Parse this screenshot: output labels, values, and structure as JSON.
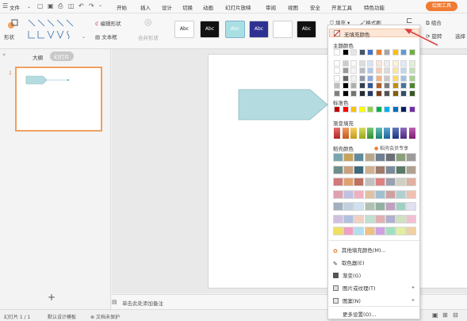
{
  "menu": {
    "file": "文件",
    "tabs": [
      "开始",
      "插入",
      "设计",
      "切换",
      "动画",
      "幻灯片放映",
      "审阅",
      "视图",
      "安全",
      "开发工具",
      "特色功能"
    ],
    "drawing_tool": "绘图工具"
  },
  "ribbon": {
    "shape_label": "形状",
    "edit_shape": "编辑形状",
    "textbox": "文本框",
    "merge_shapes": "合并形状",
    "style_sample": "Abc",
    "fill": "填充",
    "format_painter": "格式刷",
    "group": "组合",
    "rotate": "旋转",
    "select": "选择"
  },
  "left_panel": {
    "tab_outline": "大纲",
    "tab_slides": "幻灯片",
    "slide_number": "1",
    "add_icon": "+"
  },
  "notes": {
    "placeholder": "单击此处添加备注"
  },
  "status": {
    "slide_count": "幻灯片 1 / 1",
    "template": "默认设计模板",
    "protection": "文档未保护"
  },
  "fill_menu": {
    "no_fill": "无填充颜色",
    "theme_colors": "主题颜色",
    "standard_colors": "标准色",
    "gradient_fill": "渐变填充",
    "daoke_colors": "稻壳颜色",
    "member_share": "稻壳会员专享",
    "more_colors": "其他填充颜色(M)...",
    "eyedropper": "取色器(E)",
    "gradient": "渐变(G)",
    "picture_texture": "图片或纹理(T)",
    "pattern": "图案(N)",
    "more_settings": "更多设置(O)..."
  },
  "colors": {
    "accent": "#f07b33",
    "shape_fill": "#b4dce0",
    "selected_style": "#a9dfe3",
    "arrow": "#e04040"
  },
  "theme_row": [
    "#ffffff",
    "#000000",
    "#e7e6e6",
    "#44546a",
    "#4472c4",
    "#ed7d31",
    "#a5a5a5",
    "#ffc000",
    "#5b9bd5",
    "#70ad47"
  ],
  "standard_row": [
    "#c00000",
    "#ff0000",
    "#ffc000",
    "#ffff00",
    "#92d050",
    "#00b050",
    "#00b0f0",
    "#0070c0",
    "#002060",
    "#7030a0"
  ],
  "gradient_row": [
    "#e03030",
    "#f07020",
    "#f0c020",
    "#c0d020",
    "#40b040",
    "#20a090",
    "#2080c0",
    "#2040a0",
    "#6030a0",
    "#a02090"
  ],
  "daoke_rows": [
    [
      "#7aa6b0",
      "#c7a35a",
      "#5f8a9d",
      "#b7a78a",
      "#6f7f8f",
      "#6b6f77",
      "#8aa07a",
      "#9c9c9c"
    ],
    [
      "#6c8f8c",
      "#c9a080",
      "#3f6a7a",
      "#d0b090",
      "#a07a6a",
      "#7a8a9a",
      "#5a7a6a",
      "#b0a090"
    ],
    [
      "#d07a7a",
      "#e0a070",
      "#c07060",
      "#c0c0c0",
      "#e08080",
      "#9aa0b0",
      "#d0d0c0",
      "#e0b0a0"
    ],
    [
      "#e0a0b0",
      "#c0c0e0",
      "#f0b0c0",
      "#e0c0a0",
      "#a0c0d0",
      "#d0a0a0",
      "#b0d0d0",
      "#f0c0b0"
    ],
    [
      "#a0b0c0",
      "#c0d0e0",
      "#d0e0f0",
      "#b0c0b0",
      "#90b0a0",
      "#c0a0c0",
      "#a0d0c0",
      "#e0e0f0"
    ],
    [
      "#d0c0e0",
      "#b0c0e0",
      "#f0d0c0",
      "#c0e0d0",
      "#e0b0b0",
      "#b0b0d0",
      "#d0e0c0",
      "#f0c0d0"
    ],
    [
      "#f0e060",
      "#f0a0c0",
      "#b0e0f0",
      "#f0c080",
      "#d0a0e0",
      "#a0e0c0",
      "#e0f0a0",
      "#f0d0a0"
    ]
  ],
  "style_boxes": [
    {
      "bg": "#ffffff",
      "fg": "#222222"
    },
    {
      "bg": "#111111",
      "fg": "#ffffff"
    },
    {
      "bg": "#a9dfe3",
      "fg": "#ffffff"
    },
    {
      "bg": "#2e3192",
      "fg": "#ffffff"
    },
    {
      "bg": "#ffffff",
      "fg": "#ffffff"
    },
    {
      "bg": "#111111",
      "fg": "#ffffff"
    }
  ]
}
